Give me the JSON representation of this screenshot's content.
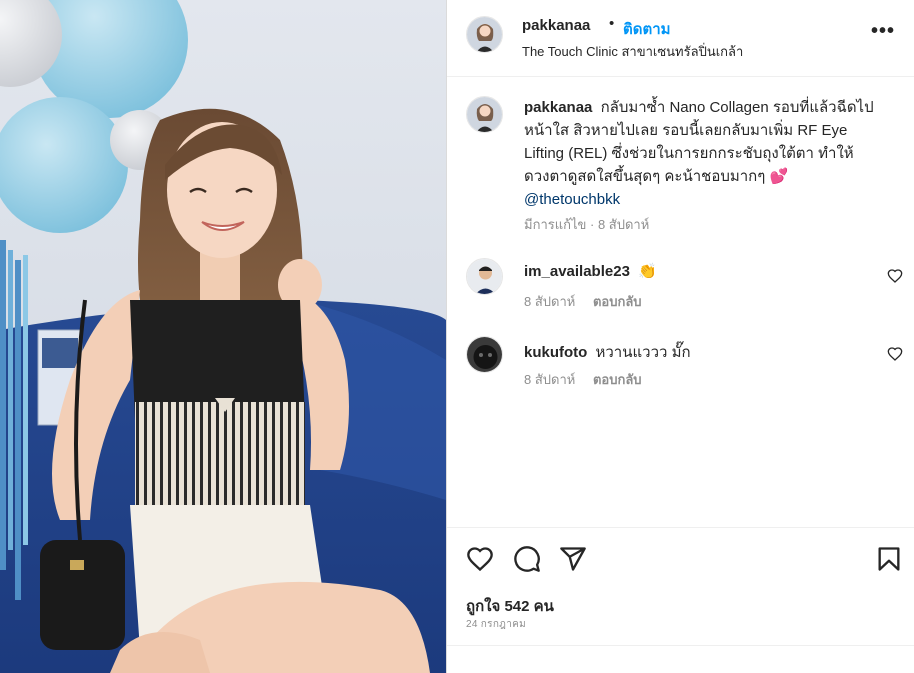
{
  "post": {
    "author": "pakkanaa",
    "follow_label": "ติดตาม",
    "dot": "•",
    "location": "The Touch Clinic สาขาเซนทรัลปิ่นเกล้า",
    "more_label": "•••"
  },
  "caption": {
    "username": "pakkanaa",
    "text": "กลับมาซ้ำ Nano Collagen รอบที่แล้วฉีดไปหน้าใส สิวหายไปเลย รอบนี้เลยกลับมาเพิ่ม RF Eye Lifting (REL) ซึ่งช่วยในการยกกระชับถุงใต้ตา ทำให้ดวงตาดูสดใสขึ้นสุดๆ คะน้าชอบมากๆ",
    "heart": "💕",
    "mention": "@thetouchbkk",
    "meta": "มีการแก้ไข · 8 สัปดาห์"
  },
  "comments": [
    {
      "username": "im_available23",
      "text": "👏",
      "time": "8 สัปดาห์",
      "reply": "ตอบกลับ"
    },
    {
      "username": "kukufoto",
      "text": "หวานแววว มั๊ก",
      "time": "8 สัปดาห์",
      "reply": "ตอบกลับ"
    }
  ],
  "actions": {
    "icons": [
      "heart-icon",
      "comment-icon",
      "share-icon",
      "bookmark-icon"
    ],
    "likes_label": "ถูกใจ 542 คน",
    "date": "24 กรกฎาคม"
  },
  "colors": {
    "accent": "#0095f6",
    "mention": "#00376b",
    "muted": "#8e8e8e",
    "text": "#262626",
    "divider": "#efefef"
  }
}
